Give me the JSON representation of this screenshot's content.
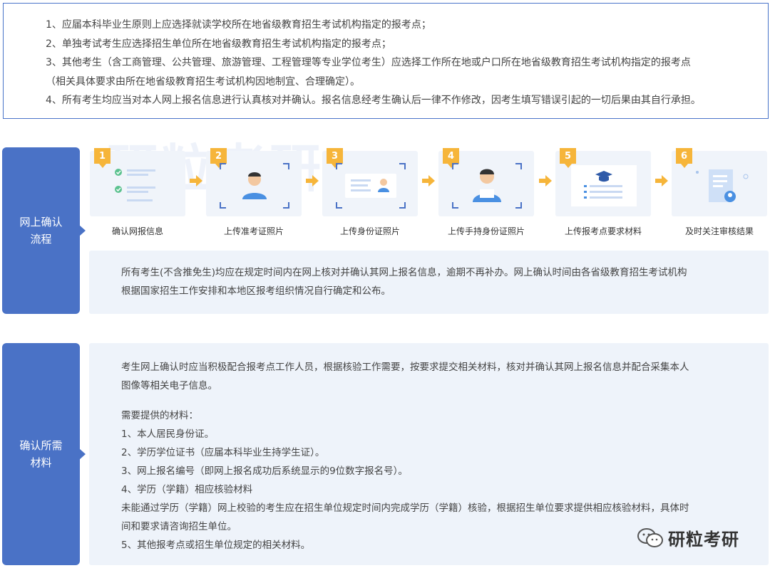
{
  "notice": {
    "lines": [
      "1、应届本科毕业生原则上应选择就读学校所在地省级教育招生考试机构指定的报考点；",
      "2、单独考试考生应选择招生单位所在地省级教育招生考试机构指定的报考点；",
      "3、其他考生（含工商管理、公共管理、旅游管理、工程管理等专业学位考生）应选择工作所在地或户口所在地省级教育招生考试机构指定的报考点",
      "（相关具体要求由所在地省级教育招生考试机构因地制宜、合理确定）。",
      "4、所有考生均应当对本人网上报名信息进行认真核对并确认。报名信息经考生确认后一律不作修改，因考生填写错误引起的一切后果由其自行承担。"
    ]
  },
  "section1": {
    "label_line1": "网上确认",
    "label_line2": "流程",
    "steps": [
      {
        "num": "1",
        "label": "确认网报信息",
        "icon": "checklist-icon"
      },
      {
        "num": "2",
        "label": "上传准考证照片",
        "icon": "portrait-frame-icon"
      },
      {
        "num": "3",
        "label": "上传身份证照片",
        "icon": "id-card-icon"
      },
      {
        "num": "4",
        "label": "上传手持身份证照片",
        "icon": "person-holding-card-icon"
      },
      {
        "num": "5",
        "label": "上传报考点要求材料",
        "icon": "graduation-doc-icon"
      },
      {
        "num": "6",
        "label": "及时关注审核结果",
        "icon": "scroll-user-icon"
      }
    ],
    "info_line1": "所有考生(不含推免生)均应在规定时间内在网上核对并确认其网上报名信息，逾期不再补办。网上确认时间由各省级教育招生考试机构",
    "info_line2": "根据国家招生工作安排和本地区报考组织情况自行确定和公布。"
  },
  "section2": {
    "label_line1": "确认所需",
    "label_line2": "材料",
    "lines": [
      "考生网上确认时应当积极配合报考点工作人员，根据核验工作需要，按要求提交相关材料，核对并确认其网上报名信息并配合采集本人",
      "图像等相关电子信息。",
      "",
      "需要提供的材料：",
      "1、本人居民身份证。",
      "2、学历学位证书（应届本科毕业生持学生证）。",
      "3、网上报名编号（即网上报名成功后系统显示的9位数字报名号）。",
      "4、学历（学籍）相应核验材料",
      "未能通过学历（学籍）网上校验的考生应在招生单位规定时间内完成学历（学籍）核验，根据招生单位要求提供相应核验材料，具体时",
      "间和要求请咨询招生单位。",
      "5、其他报考点或招生单位规定的相关材料。"
    ]
  },
  "watermark": "研粒考研",
  "brand": "研粒考研",
  "colors": {
    "accent": "#4a72c6",
    "badge": "#f6b53a",
    "panel": "#eef3fa"
  }
}
